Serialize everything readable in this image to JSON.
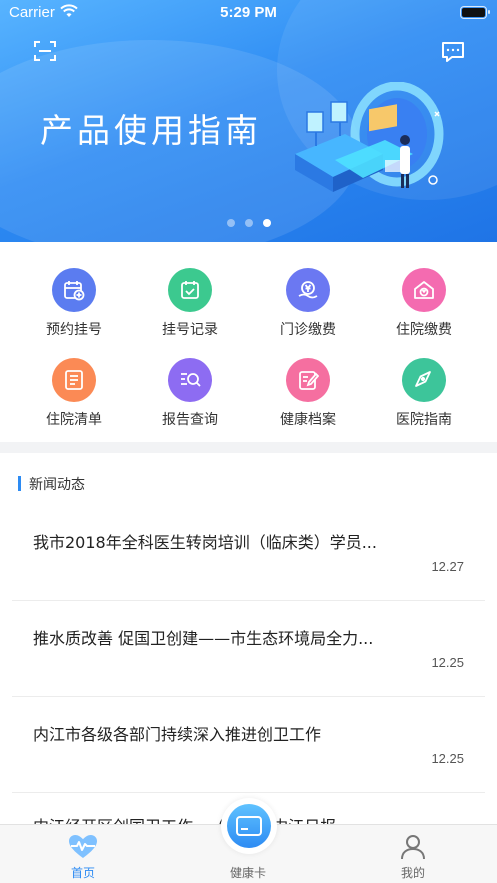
{
  "status": {
    "carrier": "Carrier",
    "time": "5:29 PM"
  },
  "banner": {
    "title": "产品使用指南",
    "slide_count": 3,
    "active_slide": 3
  },
  "quick_actions": [
    {
      "label": "预约挂号",
      "icon": "calendar-add-icon",
      "color": "#5b7cf0"
    },
    {
      "label": "挂号记录",
      "icon": "calendar-check-icon",
      "color": "#3cc98f"
    },
    {
      "label": "门诊缴费",
      "icon": "yuan-hand-icon",
      "color": "#6b78f2"
    },
    {
      "label": "住院缴费",
      "icon": "house-yuan-icon",
      "color": "#f46bb0"
    },
    {
      "label": "住院清单",
      "icon": "document-list-icon",
      "color": "#fb8a55"
    },
    {
      "label": "报告查询",
      "icon": "report-search-icon",
      "color": "#8d6cf2"
    },
    {
      "label": "健康档案",
      "icon": "record-edit-icon",
      "color": "#f56fa0"
    },
    {
      "label": "医院指南",
      "icon": "compass-icon",
      "color": "#3dc59a"
    }
  ],
  "news": {
    "section_title": "新闻动态",
    "items": [
      {
        "title": "我市2018年全科医生转岗培训（临床类）学员...",
        "date": "12.27"
      },
      {
        "title": "推水质改善  促国卫创建——市生态环境局全力...",
        "date": "12.25"
      },
      {
        "title": "内江市各级各部门持续深入推进创卫工作",
        "date": "12.25"
      },
      {
        "title": "内江经开区创国卫工作...（转载自内江日报",
        "date": ""
      }
    ]
  },
  "tabbar": {
    "tabs": [
      {
        "label": "首页",
        "icon": "heart-pulse-icon",
        "active": true
      },
      {
        "label": "健康卡",
        "icon": "card-icon",
        "active": false
      },
      {
        "label": "我的",
        "icon": "person-icon",
        "active": false
      }
    ]
  },
  "colors": {
    "brand": "#2d8bf3",
    "banner_top": "#58b4ff",
    "banner_bottom": "#1f74e6",
    "separator": "#f2f3f5"
  }
}
